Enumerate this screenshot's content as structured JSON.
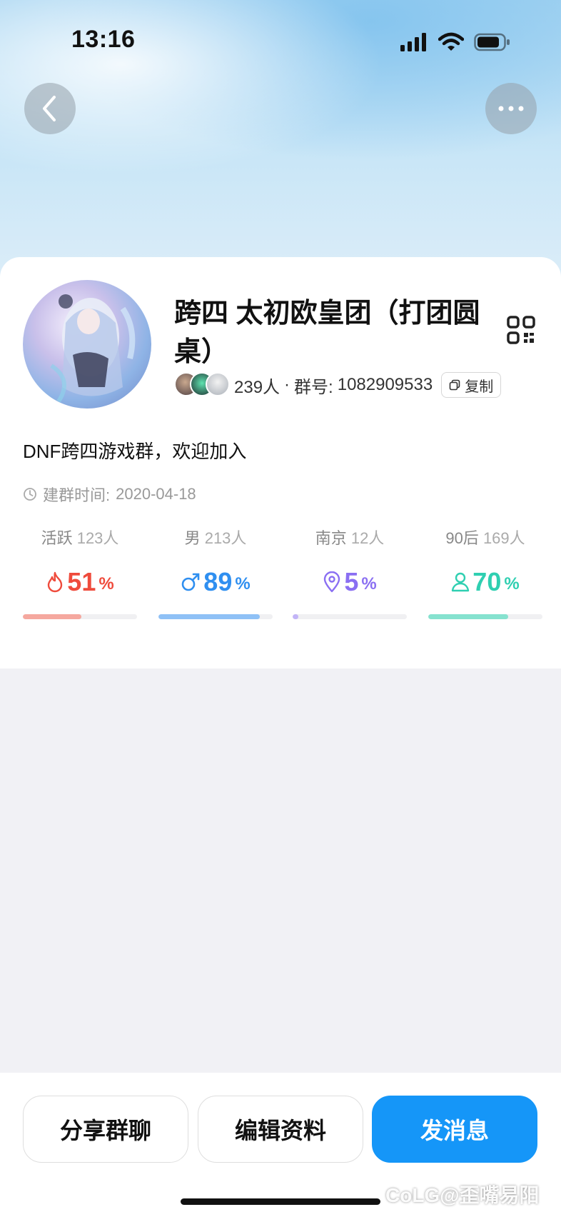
{
  "status_bar": {
    "time": "13:16"
  },
  "group": {
    "name": "跨四 太初欧皇团（打团圆桌）",
    "member_count": "239人",
    "separator": "·",
    "group_id_label": "群号:",
    "group_id": "1082909533",
    "copy_label": "复制",
    "description": "DNF跨四游戏群，欢迎加入",
    "created_label": "建群时间:",
    "created_date": "2020-04-18"
  },
  "stats": [
    {
      "label": "活跃",
      "count": "123人",
      "percent": "51",
      "unit": "%",
      "fill": 0.51,
      "icon": "flame-icon",
      "color": "#ef4b3c",
      "bar_color": "#f5a89f"
    },
    {
      "label": "男",
      "count": "213人",
      "percent": "89",
      "unit": "%",
      "fill": 0.89,
      "icon": "male-icon",
      "color": "#2f8ff0",
      "bar_color": "#8fc1f6"
    },
    {
      "label": "南京",
      "count": "12人",
      "percent": "5",
      "unit": "%",
      "fill": 0.05,
      "icon": "location-icon",
      "color": "#8a6ff2",
      "bar_color": "#c2b4f7"
    },
    {
      "label": "90后",
      "count": "169人",
      "percent": "70",
      "unit": "%",
      "fill": 0.7,
      "icon": "person-icon",
      "color": "#2fcfb1",
      "bar_color": "#86e2cf"
    }
  ],
  "actions": {
    "share": "分享群聊",
    "edit": "编辑资料",
    "message": "发消息"
  },
  "watermark": "CoLG@歪嘴易阳",
  "colors": {
    "accent": "#1596f8",
    "background": "#f1f1f5",
    "card": "#ffffff"
  }
}
